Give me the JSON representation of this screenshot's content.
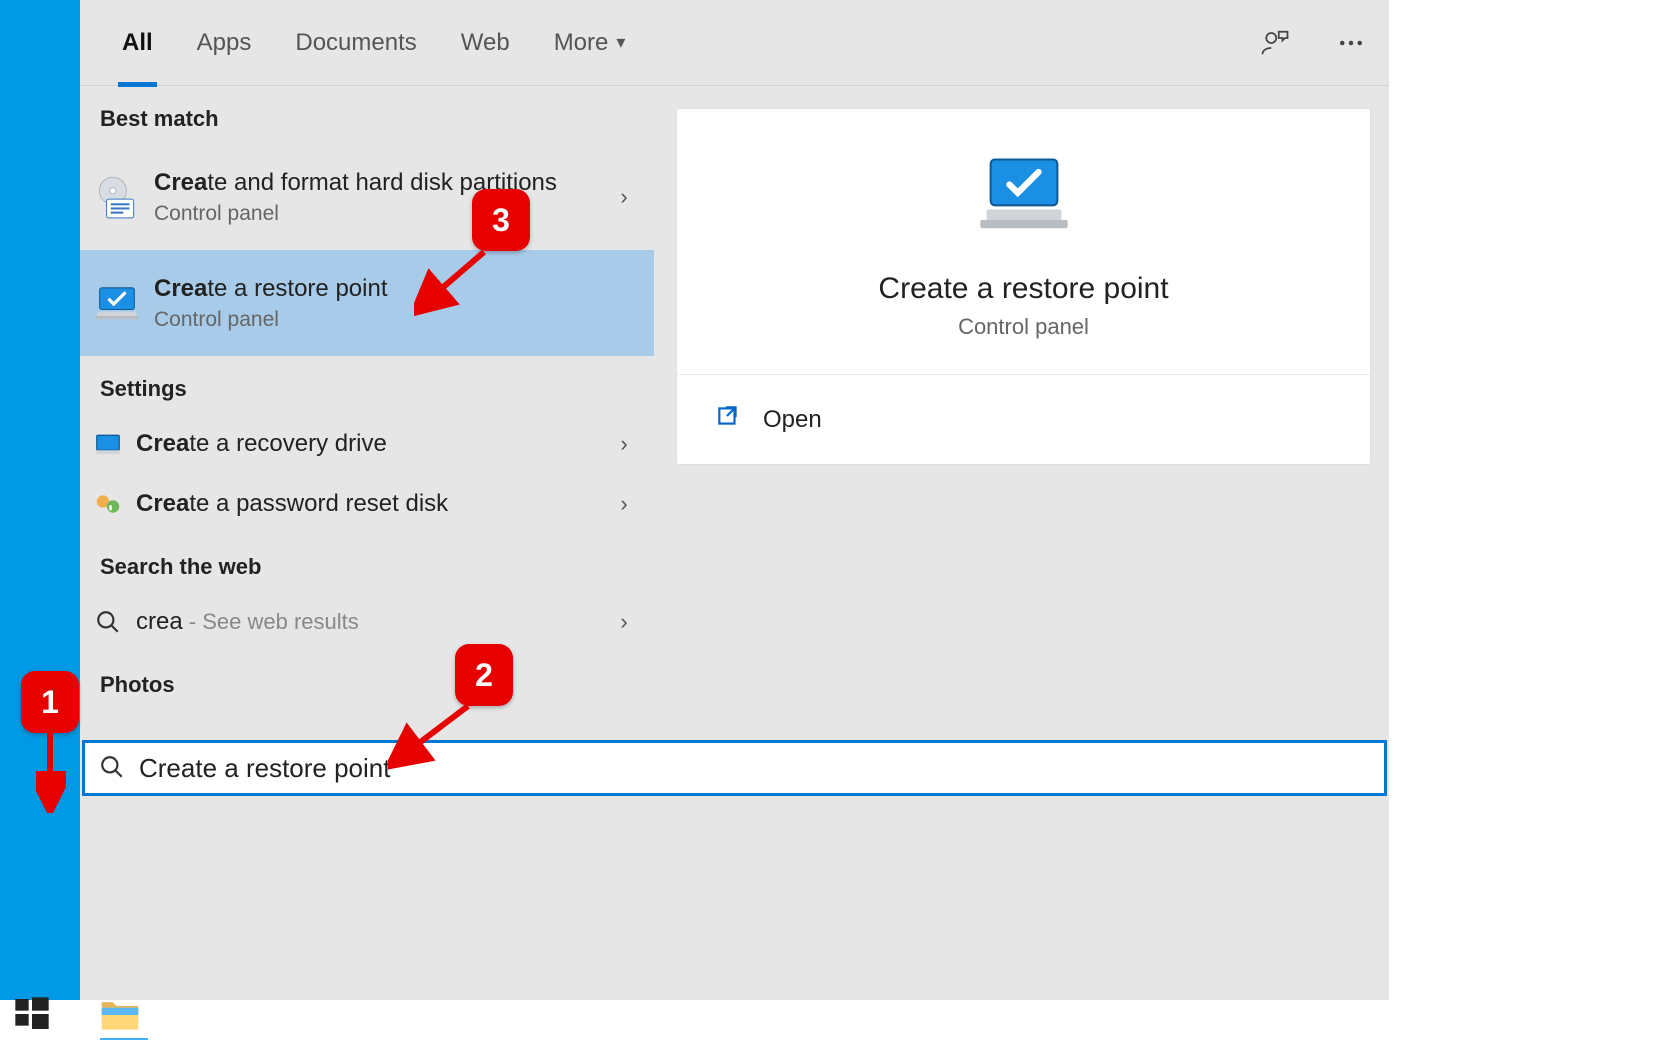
{
  "tabs": {
    "all": "All",
    "apps": "Apps",
    "documents": "Documents",
    "web": "Web",
    "more": "More"
  },
  "groups": {
    "best_match": "Best match",
    "settings": "Settings",
    "search_web": "Search the web",
    "photos": "Photos"
  },
  "results": {
    "r0": {
      "bold": "Crea",
      "rest": "te and format hard disk partitions",
      "sub": "Control panel"
    },
    "r1": {
      "bold": "Crea",
      "rest": "te a restore point",
      "sub": "Control panel"
    },
    "r2": {
      "bold": "Crea",
      "rest": "te a recovery drive"
    },
    "r3": {
      "bold": "Crea",
      "rest": "te a password reset disk"
    },
    "web": {
      "term": "crea",
      "suffix": " - See web results"
    }
  },
  "preview": {
    "title": "Create a restore point",
    "sub": "Control panel",
    "open": "Open"
  },
  "search": {
    "value": "Create a restore point"
  },
  "annotations": {
    "a1": "1",
    "a2": "2",
    "a3": "3"
  }
}
